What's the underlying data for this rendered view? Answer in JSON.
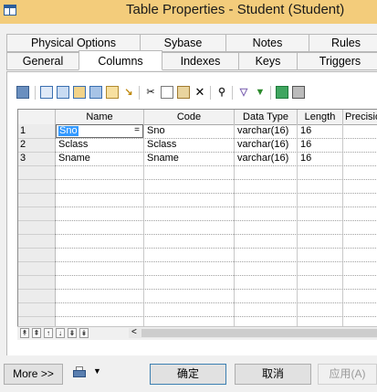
{
  "window": {
    "title": "Table Properties - Student (Student)"
  },
  "tabs_row1": [
    "Physical Options",
    "Sybase",
    "Notes",
    "Rules"
  ],
  "tabs_row2": [
    "General",
    "Columns",
    "Indexes",
    "Keys",
    "Triggers"
  ],
  "active_tab": "Columns",
  "grid": {
    "headers": [
      "Name",
      "Code",
      "Data Type",
      "Length",
      "Precisio"
    ],
    "rows": [
      {
        "num": "1",
        "name": "Sno",
        "code": "Sno",
        "type": "varchar(16)",
        "length": "16"
      },
      {
        "num": "2",
        "name": "Sclass",
        "code": "Sclass",
        "type": "varchar(16)",
        "length": "16"
      },
      {
        "num": "3",
        "name": "Sname",
        "code": "Sname",
        "type": "varchar(16)",
        "length": "16"
      }
    ],
    "edit_button": "="
  },
  "nav": {
    "buttons": [
      "↟",
      "⇞",
      "↑",
      "↓",
      "⇟",
      "↡"
    ],
    "scroll_left": "<"
  },
  "buttons": {
    "more": "More >>",
    "ok": "确定",
    "cancel": "取消",
    "apply": "应用(A)"
  },
  "colors": {
    "titlebar": "#f3cc7b",
    "selection": "#3399ff"
  }
}
